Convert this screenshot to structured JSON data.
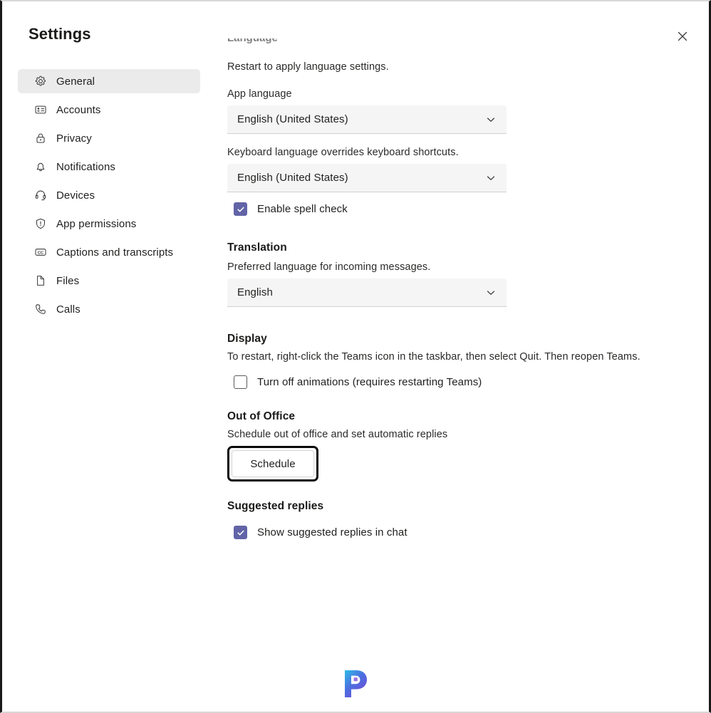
{
  "window": {
    "title": "Settings",
    "close_icon": "close-icon"
  },
  "sidebar": {
    "items": [
      {
        "label": "General",
        "icon": "gear-icon",
        "active": true
      },
      {
        "label": "Accounts",
        "icon": "id-card-icon",
        "active": false
      },
      {
        "label": "Privacy",
        "icon": "lock-icon",
        "active": false
      },
      {
        "label": "Notifications",
        "icon": "bell-icon",
        "active": false
      },
      {
        "label": "Devices",
        "icon": "headset-icon",
        "active": false
      },
      {
        "label": "App permissions",
        "icon": "shield-icon",
        "active": false
      },
      {
        "label": "Captions and transcripts",
        "icon": "cc-icon",
        "active": false
      },
      {
        "label": "Files",
        "icon": "file-icon",
        "active": false
      },
      {
        "label": "Calls",
        "icon": "phone-icon",
        "active": false
      }
    ]
  },
  "content": {
    "clipped_heading": "Language",
    "language": {
      "restart_hint": "Restart to apply language settings.",
      "app_language_label": "App language",
      "app_language_value": "English (United States)",
      "keyboard_language_hint": "Keyboard language overrides keyboard shortcuts.",
      "keyboard_language_value": "English (United States)",
      "spell_check_label": "Enable spell check",
      "spell_check_checked": true
    },
    "translation": {
      "heading": "Translation",
      "hint": "Preferred language for incoming messages.",
      "value": "English"
    },
    "display": {
      "heading": "Display",
      "hint": "To restart, right-click the Teams icon in the taskbar, then select Quit. Then reopen Teams.",
      "animations_label": "Turn off animations (requires restarting Teams)",
      "animations_checked": false
    },
    "out_of_office": {
      "heading": "Out of Office",
      "hint": "Schedule out of office and set automatic replies",
      "button_label": "Schedule"
    },
    "suggested_replies": {
      "heading": "Suggested replies",
      "label": "Show suggested replies in chat",
      "checked": true
    }
  },
  "footer": {
    "logo_icon": "p-logo-icon"
  },
  "colors": {
    "accent_purple": "#6264A7",
    "sidebar_active_bg": "#EBEBEB",
    "field_bg": "#F5F5F5",
    "focus_ring": "#0A0A0A",
    "logo_gradient_start": "#2BC4E8",
    "logo_gradient_end": "#7B3FD4"
  }
}
